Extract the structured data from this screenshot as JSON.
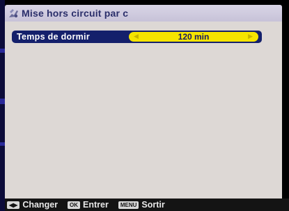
{
  "title": {
    "icon": "hand-gear-icon",
    "text": "Mise hors circuit par c"
  },
  "setting": {
    "label": "Temps de dormir",
    "value": "120 min",
    "left_arrow": "◀",
    "right_arrow": "▶"
  },
  "footer": {
    "hints": [
      {
        "key": "◀▶",
        "key_icon": "left-right-arrows-icon",
        "label": "Changer"
      },
      {
        "key": "OK",
        "key_icon": "ok-key-icon",
        "label": "Entrer"
      },
      {
        "key": "MENU",
        "key_icon": "menu-key-icon",
        "label": "Sortir"
      }
    ]
  },
  "colors": {
    "panel": "#ddd8d5",
    "title_bar": "#d0cbe0",
    "title_text": "#2a2e6a",
    "row_background": "#14206b",
    "value_box": "#f5e400",
    "footer_background": "#141414"
  }
}
